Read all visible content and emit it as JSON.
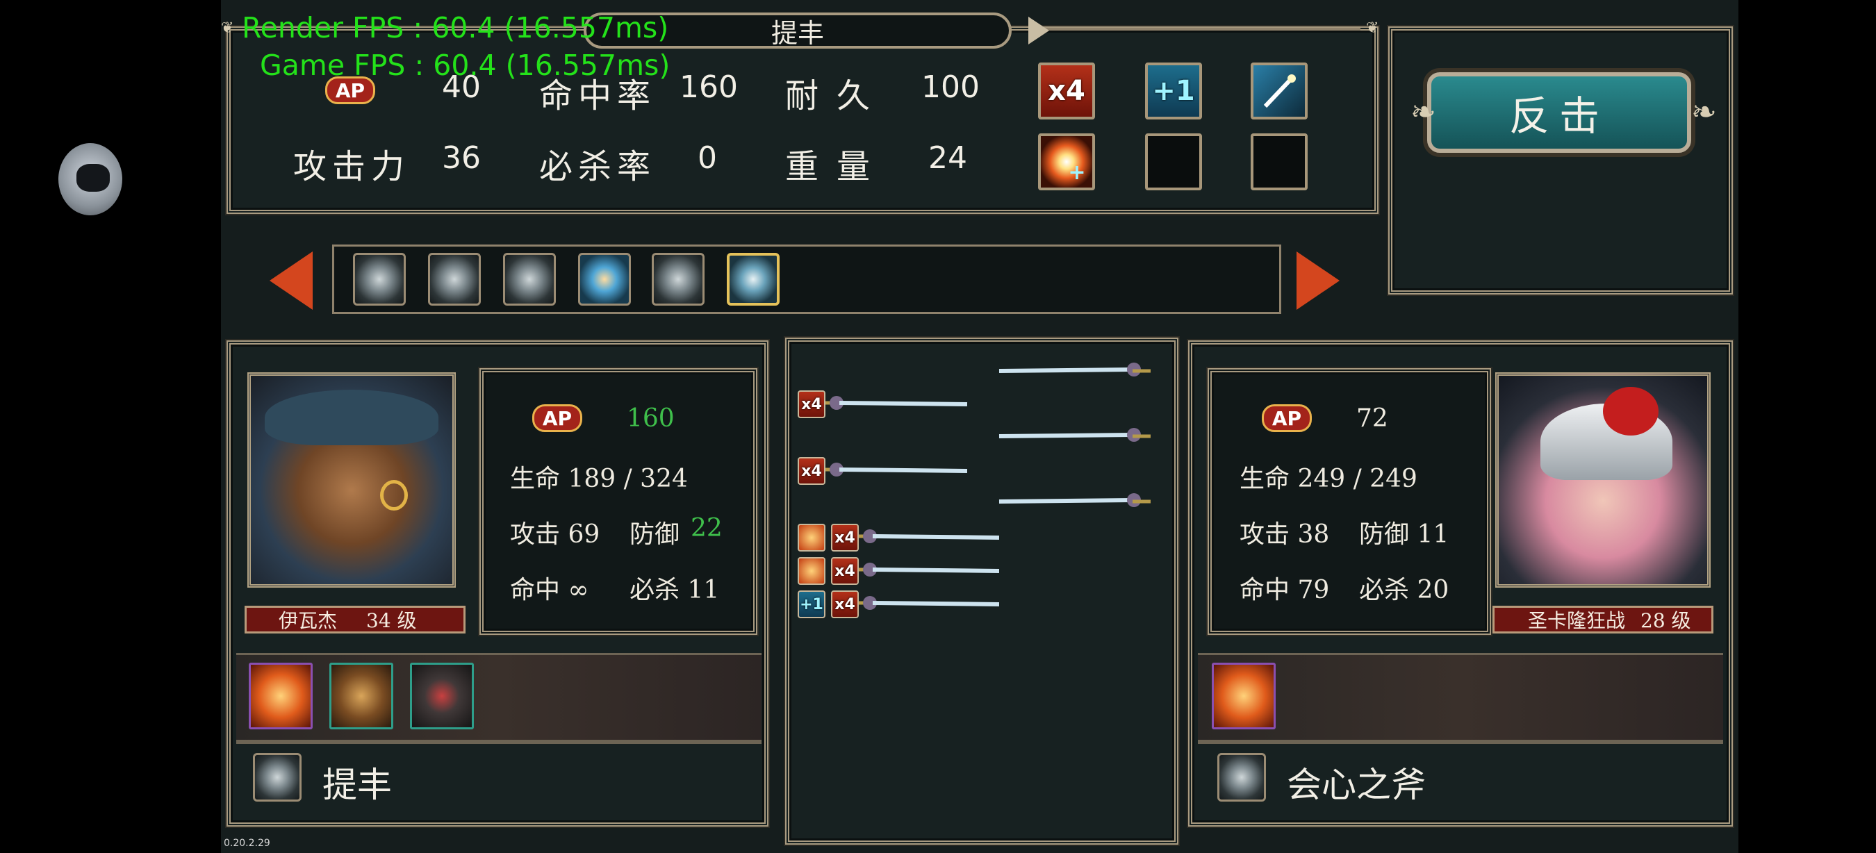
{
  "hud": {
    "render_fps": "Render FPS : 60.4 (16.557ms)",
    "game_fps": "Game FPS : 60.4 (16.557ms)",
    "version": "0.20.2.29"
  },
  "weapon_panel": {
    "title": "提丰",
    "ap_label": "AP",
    "ap_value": "40",
    "attack_label": "攻击力",
    "attack_value": "36",
    "hit_label": "命中率",
    "hit_value": "160",
    "crit_label": "必杀率",
    "crit_value": "0",
    "durability_label": "耐久",
    "durability_value": "100",
    "weight_label": "重量",
    "weight_value": "24",
    "ability_icons": [
      {
        "name": "x4-ability-icon",
        "text": "x4"
      },
      {
        "name": "plus1-ability-icon",
        "text": "+1"
      },
      {
        "name": "magic-wand-ability-icon",
        "text": ""
      },
      {
        "name": "burst-heal-ability-icon",
        "text": ""
      }
    ]
  },
  "counter_button": {
    "label": "反击"
  },
  "weapon_selector": {
    "count": 6,
    "selected_index": 5
  },
  "player": {
    "ap_label": "AP",
    "ap_value": "160",
    "hp_text": "生命 189 / 324",
    "attack_text": "攻击 69",
    "defense_label": "防御",
    "defense_value": "22",
    "hit_text": "命中 ∞",
    "crit_text": "必杀 11",
    "name": "伊瓦杰",
    "level_text": "34 级",
    "weapon_name": "提丰"
  },
  "enemy": {
    "ap_label": "AP",
    "ap_value": "72",
    "hp_text": "生命 249 / 249",
    "attack_text": "攻击 38",
    "defense_text": "防御 11",
    "hit_text": "命中 79",
    "crit_text": "必杀 20",
    "name": "圣卡隆狂战",
    "level_text": "28 级",
    "weapon_name": "会心之斧"
  },
  "attack_sequence": {
    "mini_badges": [
      "x4",
      "x4",
      "x4",
      "x4",
      "x4",
      "+1",
      "x4"
    ]
  },
  "colors": {
    "accent_green": "#3fbf4b",
    "fps_green": "#24e21a",
    "frame_gold": "#a89a80",
    "counter_teal": "#1d6f73"
  }
}
